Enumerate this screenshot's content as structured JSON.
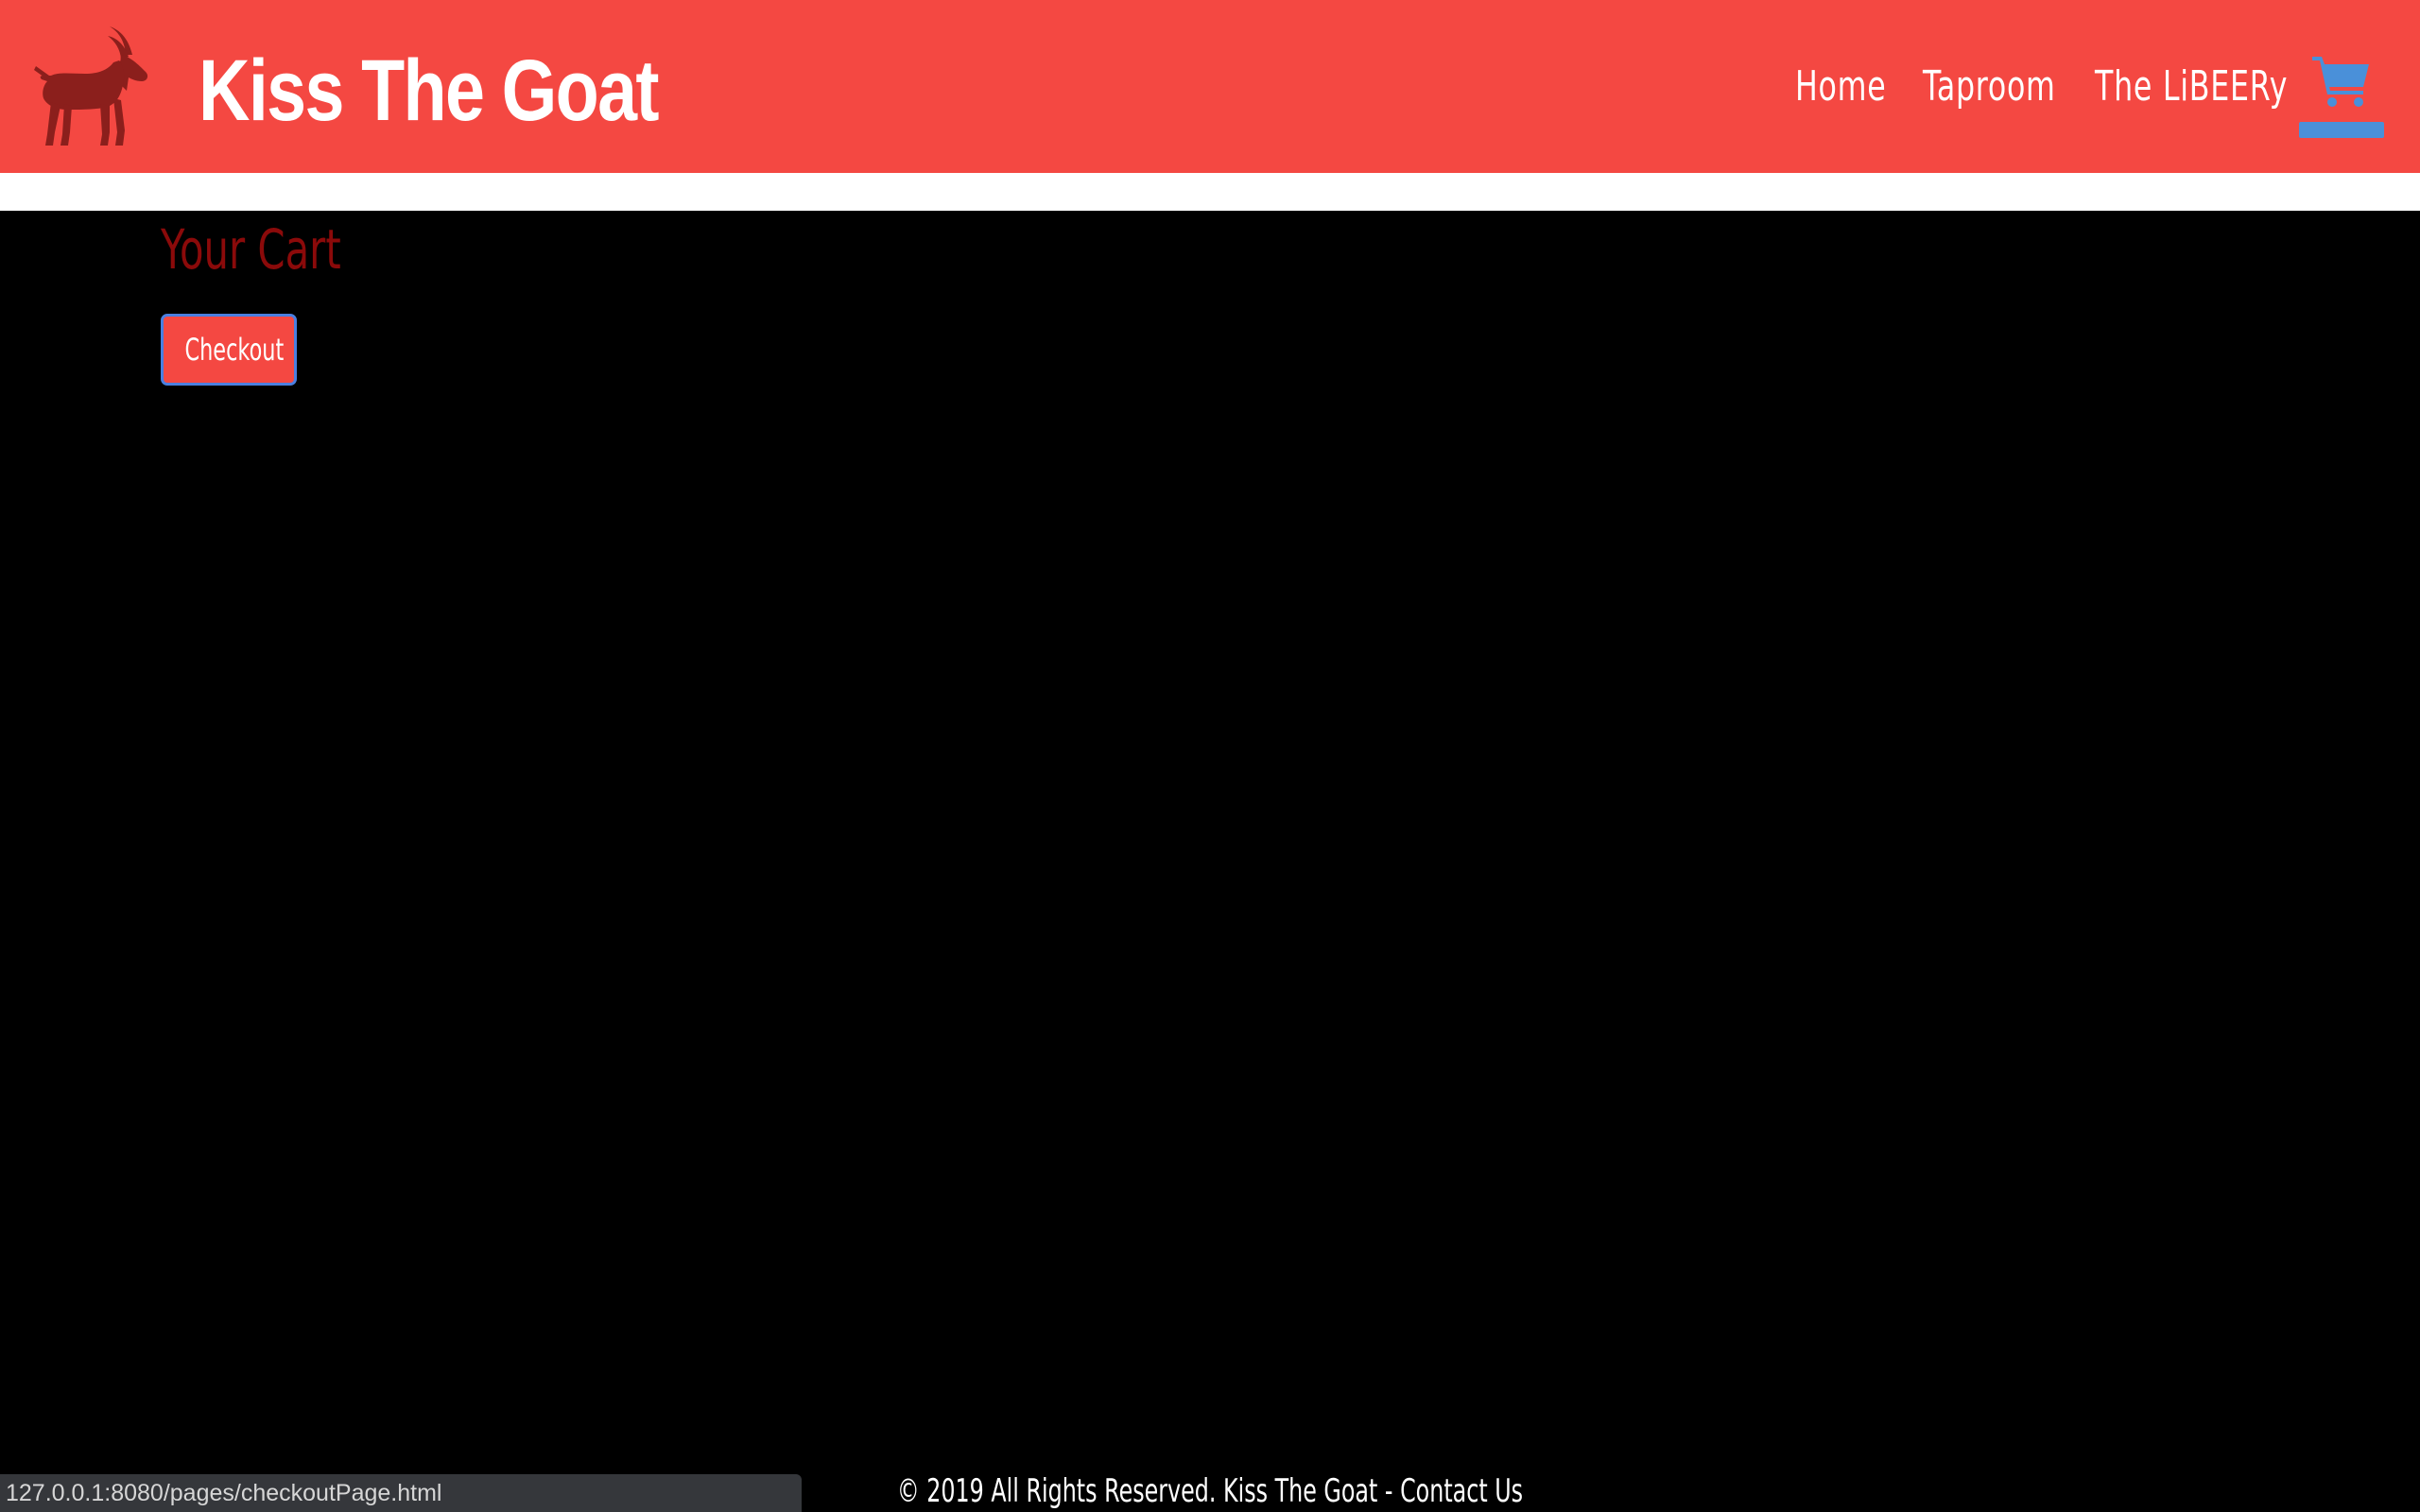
{
  "colors": {
    "header_bg": "#f44842",
    "logo": "#8b1f1c",
    "title": "#8b0a0a",
    "cart_accent": "#4a90d9",
    "button_border": "#4a7fe0",
    "page_bg": "#000000"
  },
  "header": {
    "logo_icon": "goat-icon",
    "brand": "Kiss The Goat",
    "nav": {
      "home": "Home",
      "taproom": "Taproom",
      "libeery": "The LiBEERy"
    },
    "cart_icon": "shopping-cart-icon"
  },
  "main": {
    "title": "Your Cart",
    "checkout_label": "Checkout"
  },
  "footer": {
    "copyright": "© 2019 All Rights Reserved. Kiss The Goat",
    "separator": " - ",
    "contact": "Contact Us"
  },
  "status_bar": {
    "url": "127.0.0.1:8080/pages/checkoutPage.html"
  }
}
